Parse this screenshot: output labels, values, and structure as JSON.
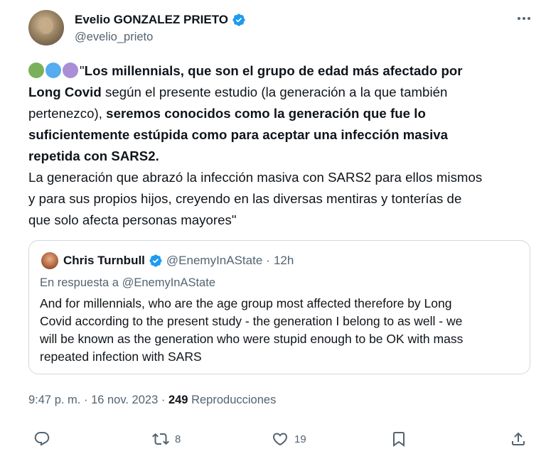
{
  "author": {
    "name": "Evelio GONZALEZ PRIETO",
    "handle": "@evelio_prieto"
  },
  "tweet": {
    "circle_colors": [
      "#78b159",
      "#55acee",
      "#aa8ed6"
    ],
    "lines": [
      [
        {
          "t": "\"",
          "b": false
        },
        {
          "t": "Los millennials, que son el grupo de edad más afectado por",
          "b": true
        }
      ],
      [
        {
          "t": "Long Covid",
          "b": true
        },
        {
          "t": " según el presente estudio (la generación a la que también",
          "b": false
        }
      ],
      [
        {
          "t": "pertenezco), ",
          "b": false
        },
        {
          "t": "seremos conocidos como la generación que fue lo",
          "b": true
        }
      ],
      [
        {
          "t": "suficientemente estúpida como para aceptar una infección masiva",
          "b": true
        }
      ],
      [
        {
          "t": "repetida con SARS2.",
          "b": true
        }
      ],
      [
        {
          "t": "La generación que abrazó la infección masiva con SARS2 para ellos mismos",
          "b": false
        }
      ],
      [
        {
          "t": "y para sus propios hijos, creyendo en las diversas mentiras y tonterías de",
          "b": false
        }
      ],
      [
        {
          "t": "que solo afecta personas mayores\"",
          "b": false
        }
      ]
    ]
  },
  "quote": {
    "name": "Chris Turnbull",
    "handle": "@EnemyInAState",
    "time": "12h",
    "separator": "·",
    "reply_prefix": "En respuesta a",
    "reply_handle": "@EnemyInAState",
    "lines": [
      "And for millennials, who are the age group most affected therefore by Long",
      "Covid according to the present study - the generation I belong to as well - we",
      "will be known as the generation who were stupid enough to be OK with mass",
      "repeated  infection with SARS"
    ]
  },
  "meta": {
    "time": "9:47 p. m.",
    "separator": "·",
    "date": "16 nov. 2023",
    "views_count": "249",
    "views_label": "Reproducciones"
  },
  "actions": {
    "retweets": "8",
    "likes": "19"
  }
}
